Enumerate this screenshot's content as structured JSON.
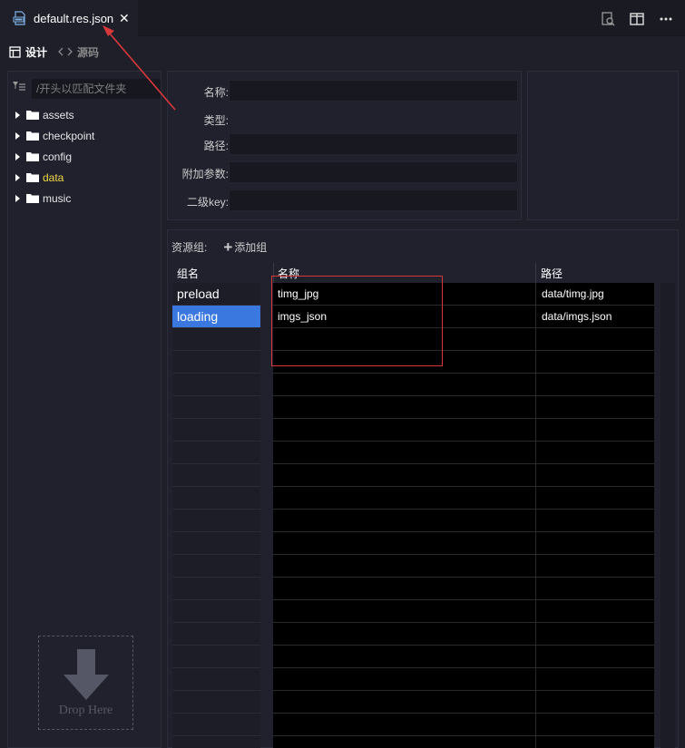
{
  "tab": {
    "title": "default.res.json",
    "close": "✕"
  },
  "view": {
    "design_label": "设计",
    "source_label": "源码"
  },
  "sidebar": {
    "filter_placeholder": "/开头以匹配文件夹",
    "items": [
      {
        "label": "assets",
        "highlight": false
      },
      {
        "label": "checkpoint",
        "highlight": false
      },
      {
        "label": "config",
        "highlight": false
      },
      {
        "label": "data",
        "highlight": true
      },
      {
        "label": "music",
        "highlight": false
      }
    ],
    "drop_text": "Drop Here"
  },
  "props": {
    "name_label": "名称:",
    "type_label": "类型:",
    "path_label": "路径:",
    "params_label": "附加参数:",
    "subkey_label": "二级key:"
  },
  "resources": {
    "group_label": "资源组:",
    "add_group": "添加组",
    "col_group": "组名",
    "col_name": "名称",
    "col_path": "路径",
    "groups": [
      {
        "name": "preload",
        "selected": false
      },
      {
        "name": "loading",
        "selected": true
      }
    ],
    "rows": [
      {
        "name": "timg_jpg",
        "path": "data/timg.jpg"
      },
      {
        "name": "imgs_json",
        "path": "data/imgs.json"
      }
    ]
  },
  "colors": {
    "accent": "#3a78e0",
    "highlight_folder": "#f0d847",
    "annotation": "#d9383a"
  }
}
